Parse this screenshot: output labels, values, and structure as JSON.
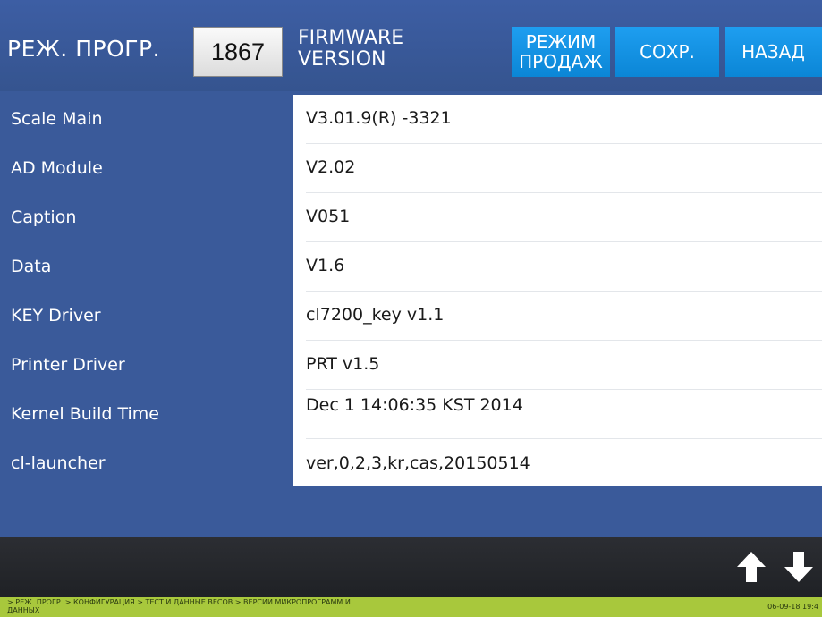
{
  "header": {
    "mode_title": "РЕЖ. ПРОГР.",
    "code": "1867",
    "screen_title_line1": "FIRMWARE",
    "screen_title_line2": "VERSION",
    "buttons": {
      "sale_mode_line1": "РЕЖИМ",
      "sale_mode_line2": "ПРОДАЖ",
      "save": "СОХР.",
      "back": "НАЗАД"
    }
  },
  "rows": [
    {
      "label": "Scale Main",
      "value": "V3.01.9(R) -3321"
    },
    {
      "label": "AD Module",
      "value": "V2.02"
    },
    {
      "label": "Caption",
      "value": "V051"
    },
    {
      "label": "Data",
      "value": "V1.6"
    },
    {
      "label": "KEY Driver",
      "value": "cl7200_key v1.1"
    },
    {
      "label": "Printer Driver",
      "value": "PRT v1.5"
    },
    {
      "label": "Kernel Build Time",
      "value": "Dec 1 14:06:35 KST 2014"
    },
    {
      "label": "cl-launcher",
      "value": "ver,0,2,3,kr,cas,20150514"
    }
  ],
  "footer": {
    "up_icon": "arrow-up-icon",
    "down_icon": "arrow-down-icon"
  },
  "status": {
    "breadcrumb": "> РЕЖ. ПРОГР. > КОНФИГУРАЦИЯ > ТЕСТ И ДАННЫЕ ВЕСОВ > ВЕРСИИ МИКРОПРОГРАММ И ДАННЫХ",
    "datetime": "06-09-18 19:4"
  },
  "colors": {
    "background": "#3a5a9a",
    "button": "#1490e0",
    "footer": "#26282c",
    "statusbar": "#a8c83c"
  }
}
